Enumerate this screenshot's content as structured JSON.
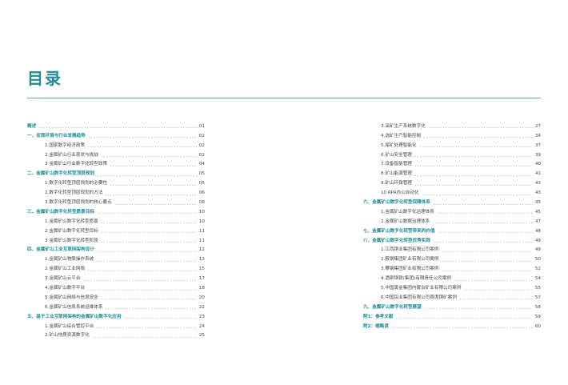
{
  "title": "目录",
  "left_column": [
    {
      "label": "概述",
      "page": "01",
      "level": 0
    },
    {
      "label": "一、宏观环境与行业发展趋势",
      "page": "02",
      "level": 0
    },
    {
      "label": "1.国家数字经济政策",
      "page": "02",
      "level": 1
    },
    {
      "label": "2.金属矿山行业现状与挑战",
      "page": "02",
      "level": 1
    },
    {
      "label": "3.金属矿山行业数字化转型政策",
      "page": "04",
      "level": 1
    },
    {
      "label": "二、金属矿山数字化转型顶层规划",
      "page": "05",
      "level": 0
    },
    {
      "label": "1.数字化转型顶层规划的必要性",
      "page": "05",
      "level": 1
    },
    {
      "label": "2.数字化转型顶层规划的方法",
      "page": "06",
      "level": 1
    },
    {
      "label": "3.数字化转型顶层规划的核心要点",
      "page": "08",
      "level": 1
    },
    {
      "label": "三、金属矿山数字化转型愿景目标",
      "page": "10",
      "level": 0
    },
    {
      "label": "1.金属矿山数字化转型愿景",
      "page": "10",
      "level": 1
    },
    {
      "label": "2.金属矿山数字化转型目标",
      "page": "11",
      "level": 1
    },
    {
      "label": "3.金属矿山数字化转型阶段",
      "page": "11",
      "level": 1
    },
    {
      "label": "四、金属矿山工业互联网架构设计",
      "page": "12",
      "level": 0
    },
    {
      "label": "1.金属矿山物联操作系统",
      "page": "13",
      "level": 1
    },
    {
      "label": "2.金属矿山工业网络",
      "page": "15",
      "level": 1
    },
    {
      "label": "3.金属矿山云平台",
      "page": "17",
      "level": 1
    },
    {
      "label": "4.金属矿山数字平台",
      "page": "18",
      "level": 1
    },
    {
      "label": "5.金属矿山网络与信息安全",
      "page": "20",
      "level": 1
    },
    {
      "label": "6.金属矿山信息系统运维体系",
      "page": "22",
      "level": 1
    },
    {
      "label": "五、基于工业互联网架构的金属矿山数字化应用",
      "page": "23",
      "level": 0
    },
    {
      "label": "1.金属矿山综合管控平台",
      "page": "24",
      "level": 1
    },
    {
      "label": "2.矿山地质资源数字化",
      "page": "25",
      "level": 1
    }
  ],
  "right_column": [
    {
      "label": "3.采矿生产系统数字化",
      "page": "27",
      "level": 1
    },
    {
      "label": "4.选矿生产智能控制",
      "page": "34",
      "level": 1
    },
    {
      "label": "5.尾矿处理智能化",
      "page": "37",
      "level": 1
    },
    {
      "label": "6.矿山安全管理",
      "page": "39",
      "level": 1
    },
    {
      "label": "7.设备智能管理",
      "page": "40",
      "level": 1
    },
    {
      "label": "8.矿山能源管理",
      "page": "41",
      "level": 1
    },
    {
      "label": "9.矿山环保管理",
      "page": "43",
      "level": 1
    },
    {
      "label": "10.RPA办公自动化",
      "page": "43",
      "level": 1
    },
    {
      "label": "六、金属矿山数字化转型保障体系",
      "page": "45",
      "level": 0
    },
    {
      "label": "1.金属矿山数字化治理体系",
      "page": "45",
      "level": 1
    },
    {
      "label": "2.金属矿山数据治理体系",
      "page": "47",
      "level": 1
    },
    {
      "label": "七、金属矿山数字化转型带来的价值",
      "page": "48",
      "level": 0
    },
    {
      "label": "八、金属矿山数字化转型优秀实践",
      "page": "49",
      "level": 0
    },
    {
      "label": "1.江西铜业集团有限公司案例",
      "page": "49",
      "level": 1
    },
    {
      "label": "2.鞍钢集团矿业有限公司案例",
      "page": "50",
      "level": 1
    },
    {
      "label": "3.攀钢集团矿业有限公司案例",
      "page": "52",
      "level": 1
    },
    {
      "label": "4.酒泉钢铁(集团)有限责任公司案例",
      "page": "54",
      "level": 1
    },
    {
      "label": "5.中国黄金集团内蒙古矿业有限公司案例",
      "page": "55",
      "level": 1
    },
    {
      "label": "6.中国铝业集团有限公司首席铜矿案例",
      "page": "57",
      "level": 1
    },
    {
      "label": "九、金属矿山数字化转型展望",
      "page": "58",
      "level": 0
    },
    {
      "label": "附1：参考文献",
      "page": "59",
      "level": 0
    },
    {
      "label": "附2：缩略语",
      "page": "60",
      "level": 0
    }
  ],
  "colors": {
    "accent": "#1f8c98",
    "rule": "#5aa7b0",
    "text": "#444444"
  }
}
